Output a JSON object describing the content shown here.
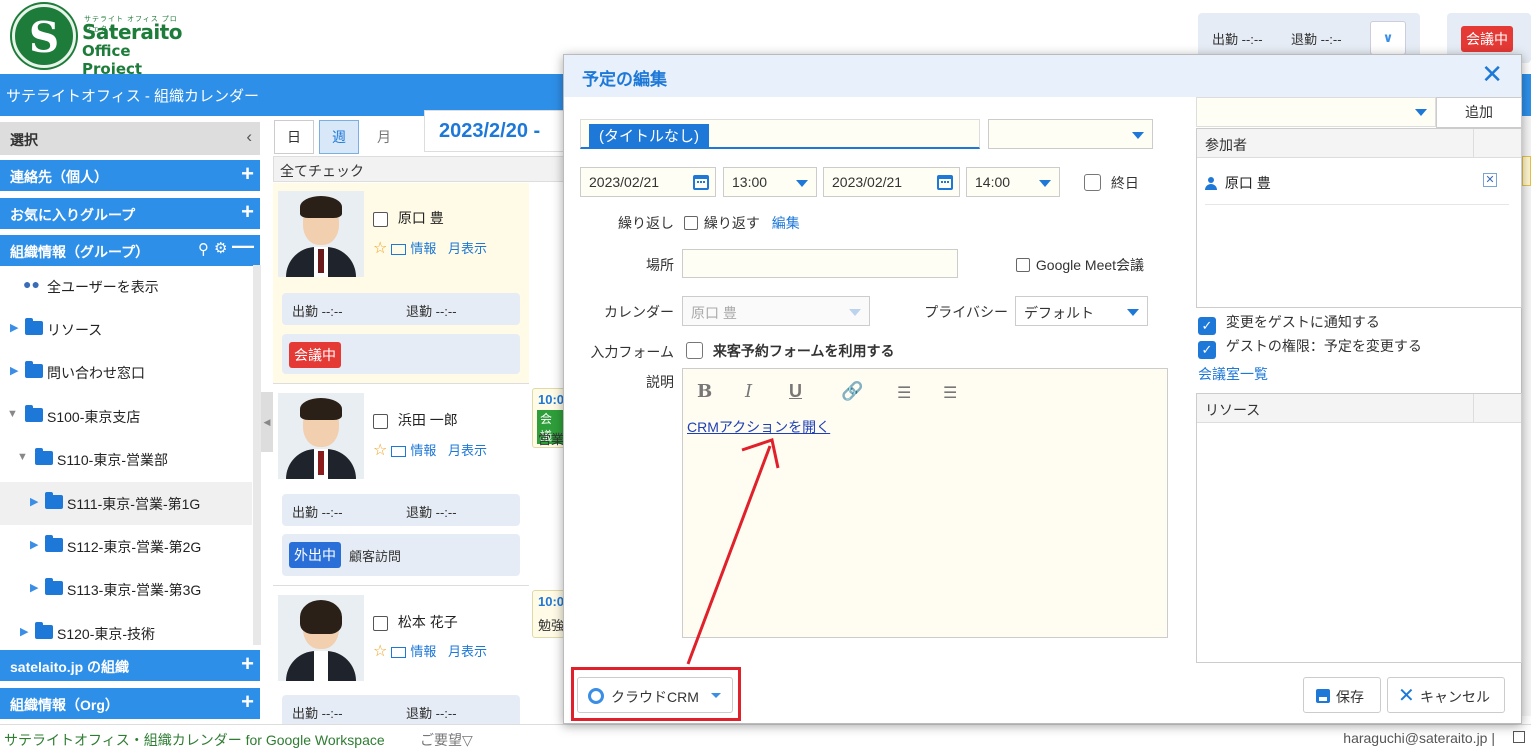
{
  "logo": {
    "small": "サテライト オフィス プロジェクト",
    "line1": "Sateraito",
    "line2": "Office Project"
  },
  "header": {
    "attend_in": "出勤 --:--",
    "attend_out": "退勤 --:--",
    "meeting_badge": "会議中",
    "app_title": "サテライトオフィス - 組織カレンダー"
  },
  "sidebar": {
    "select_label": "選択",
    "groups": {
      "contacts": "連絡先（個人）",
      "favorites": "お気に入りグループ",
      "org_groups": "組織情報（グループ）",
      "satelaito": "satelaito.jp の組織",
      "org": "組織情報（Org）"
    },
    "show_all_users": "全ユーザーを表示",
    "tree": [
      {
        "label": "リソース"
      },
      {
        "label": "問い合わせ窓口"
      },
      {
        "label": "S100-東京支店"
      },
      {
        "label": "S110-東京-営業部"
      },
      {
        "label": "S111-東京-営業-第1G"
      },
      {
        "label": "S112-東京-営業-第2G"
      },
      {
        "label": "S113-東京-営業-第3G"
      },
      {
        "label": "S120-東京-技術"
      }
    ]
  },
  "calendar": {
    "views": [
      "日",
      "週",
      "月"
    ],
    "date_range": "2023/2/20 -",
    "check_all": "全てチェック",
    "info_link": "情報",
    "month_link": "月表示",
    "attend_in": "出勤 --:--",
    "attend_out": "退勤 --:--",
    "people": [
      {
        "name": "原口 豊",
        "status": "会議中"
      },
      {
        "name": "浜田 一郎",
        "status": "外出中",
        "note": "顧客訪問",
        "event_time": "10:0",
        "event_tag": "会議",
        "event_text": "営業"
      },
      {
        "name": "松本 花子",
        "event_time": "10:0",
        "event_text": "勉強"
      }
    ]
  },
  "modal": {
    "title": "予定の編集",
    "event_title": "(タイトルなし)",
    "start_date": "2023/02/21",
    "start_time": "13:00",
    "end_date": "2023/02/21",
    "end_time": "14:00",
    "all_day": "終日",
    "repeat_label": "繰り返し",
    "repeat_check": "繰り返す",
    "repeat_edit": "編集",
    "location_label": "場所",
    "google_meet": "Google Meet会議",
    "calendar_label": "カレンダー",
    "calendar_value": "原口 豊",
    "privacy_label": "プライバシー",
    "privacy_value": "デフォルト",
    "form_label": "入力フォーム",
    "form_check": "来客予約フォームを利用する",
    "desc_label": "説明",
    "editor_tools": {
      "bold": "B",
      "italic": "I",
      "underline": "U"
    },
    "crm_link": "CRMアクションを開く",
    "add_button": "追加",
    "attendees_header": "参加者",
    "attendee": "原口 豊",
    "notify_guests": "変更をゲストに通知する",
    "guest_permission": "ゲストの権限：予定を変更する",
    "room_list": "会議室一覧",
    "resources_header": "リソース",
    "crm_button": "クラウドCRM",
    "save": "保存",
    "cancel": "キャンセル"
  },
  "footer": {
    "app": "サテライトオフィス・組織カレンダー for Google Workspace",
    "request": "ご要望▽",
    "user": "haraguchi@sateraito.jp |"
  }
}
